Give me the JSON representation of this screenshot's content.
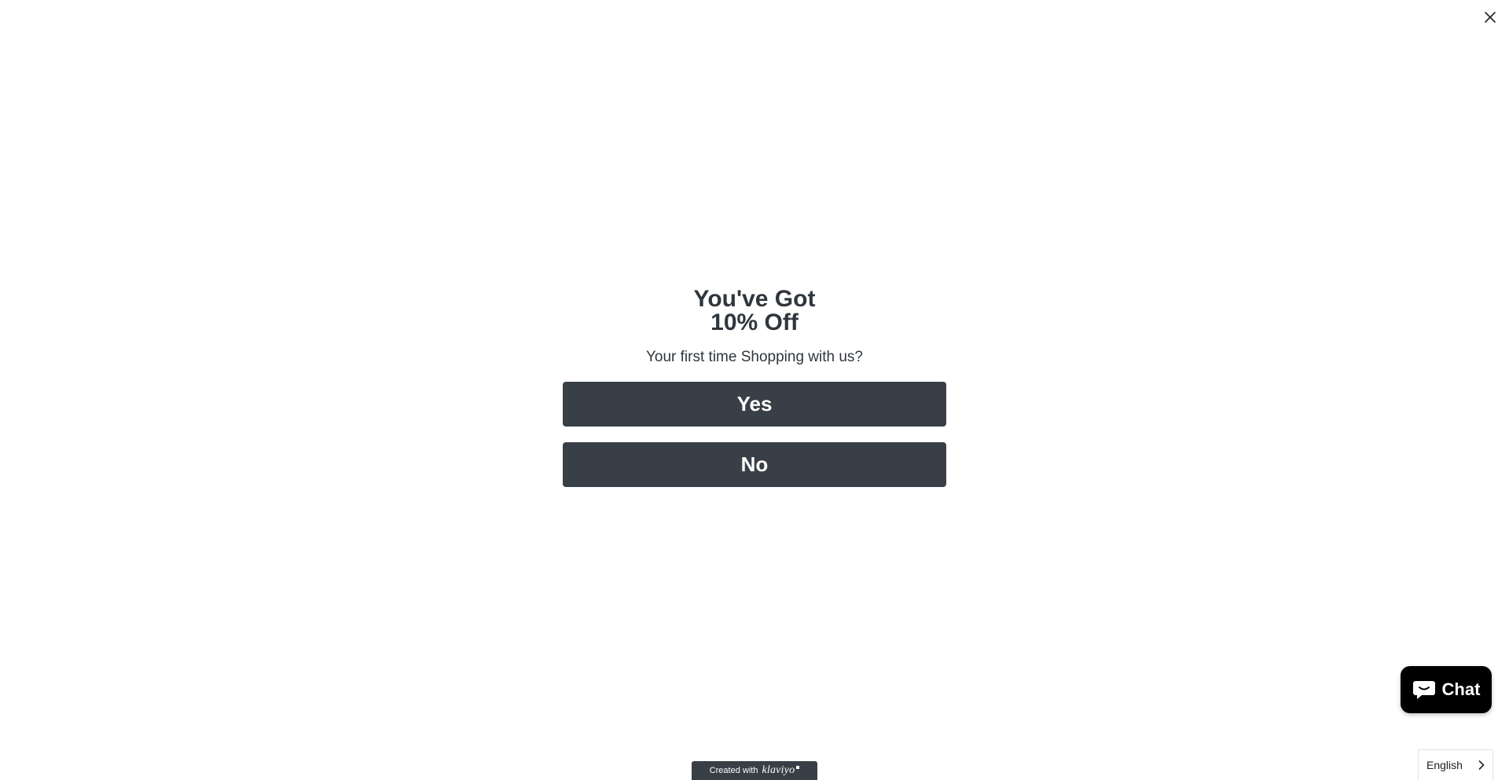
{
  "popup": {
    "headline_line1": "You've Got",
    "headline_line2": "10% Off",
    "subtitle": "Your first time Shopping with us?",
    "yes_label": "Yes",
    "no_label": "No",
    "close_icon": "close-icon"
  },
  "branding": {
    "prefix": "Created with",
    "brand": "klaviyo"
  },
  "chat": {
    "label": "Chat",
    "icon": "chat-bubble-icon"
  },
  "language": {
    "selected": "English",
    "icon": "chevron-right-icon"
  },
  "colors": {
    "button_bg": "#393f46",
    "text": "#30363d",
    "chat_bg": "#000000"
  }
}
